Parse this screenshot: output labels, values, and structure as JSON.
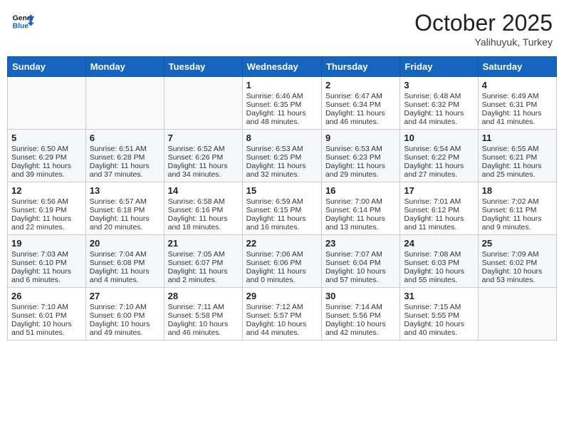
{
  "header": {
    "logo_general": "General",
    "logo_blue": "Blue",
    "month": "October 2025",
    "location": "Yalihuyuk, Turkey"
  },
  "weekdays": [
    "Sunday",
    "Monday",
    "Tuesday",
    "Wednesday",
    "Thursday",
    "Friday",
    "Saturday"
  ],
  "weeks": [
    [
      {
        "day": "",
        "content": ""
      },
      {
        "day": "",
        "content": ""
      },
      {
        "day": "",
        "content": ""
      },
      {
        "day": "1",
        "content": "Sunrise: 6:46 AM\nSunset: 6:35 PM\nDaylight: 11 hours\nand 48 minutes."
      },
      {
        "day": "2",
        "content": "Sunrise: 6:47 AM\nSunset: 6:34 PM\nDaylight: 11 hours\nand 46 minutes."
      },
      {
        "day": "3",
        "content": "Sunrise: 6:48 AM\nSunset: 6:32 PM\nDaylight: 11 hours\nand 44 minutes."
      },
      {
        "day": "4",
        "content": "Sunrise: 6:49 AM\nSunset: 6:31 PM\nDaylight: 11 hours\nand 41 minutes."
      }
    ],
    [
      {
        "day": "5",
        "content": "Sunrise: 6:50 AM\nSunset: 6:29 PM\nDaylight: 11 hours\nand 39 minutes."
      },
      {
        "day": "6",
        "content": "Sunrise: 6:51 AM\nSunset: 6:28 PM\nDaylight: 11 hours\nand 37 minutes."
      },
      {
        "day": "7",
        "content": "Sunrise: 6:52 AM\nSunset: 6:26 PM\nDaylight: 11 hours\nand 34 minutes."
      },
      {
        "day": "8",
        "content": "Sunrise: 6:53 AM\nSunset: 6:25 PM\nDaylight: 11 hours\nand 32 minutes."
      },
      {
        "day": "9",
        "content": "Sunrise: 6:53 AM\nSunset: 6:23 PM\nDaylight: 11 hours\nand 29 minutes."
      },
      {
        "day": "10",
        "content": "Sunrise: 6:54 AM\nSunset: 6:22 PM\nDaylight: 11 hours\nand 27 minutes."
      },
      {
        "day": "11",
        "content": "Sunrise: 6:55 AM\nSunset: 6:21 PM\nDaylight: 11 hours\nand 25 minutes."
      }
    ],
    [
      {
        "day": "12",
        "content": "Sunrise: 6:56 AM\nSunset: 6:19 PM\nDaylight: 11 hours\nand 22 minutes."
      },
      {
        "day": "13",
        "content": "Sunrise: 6:57 AM\nSunset: 6:18 PM\nDaylight: 11 hours\nand 20 minutes."
      },
      {
        "day": "14",
        "content": "Sunrise: 6:58 AM\nSunset: 6:16 PM\nDaylight: 11 hours\nand 18 minutes."
      },
      {
        "day": "15",
        "content": "Sunrise: 6:59 AM\nSunset: 6:15 PM\nDaylight: 11 hours\nand 16 minutes."
      },
      {
        "day": "16",
        "content": "Sunrise: 7:00 AM\nSunset: 6:14 PM\nDaylight: 11 hours\nand 13 minutes."
      },
      {
        "day": "17",
        "content": "Sunrise: 7:01 AM\nSunset: 6:12 PM\nDaylight: 11 hours\nand 11 minutes."
      },
      {
        "day": "18",
        "content": "Sunrise: 7:02 AM\nSunset: 6:11 PM\nDaylight: 11 hours\nand 9 minutes."
      }
    ],
    [
      {
        "day": "19",
        "content": "Sunrise: 7:03 AM\nSunset: 6:10 PM\nDaylight: 11 hours\nand 6 minutes."
      },
      {
        "day": "20",
        "content": "Sunrise: 7:04 AM\nSunset: 6:08 PM\nDaylight: 11 hours\nand 4 minutes."
      },
      {
        "day": "21",
        "content": "Sunrise: 7:05 AM\nSunset: 6:07 PM\nDaylight: 11 hours\nand 2 minutes."
      },
      {
        "day": "22",
        "content": "Sunrise: 7:06 AM\nSunset: 6:06 PM\nDaylight: 11 hours\nand 0 minutes."
      },
      {
        "day": "23",
        "content": "Sunrise: 7:07 AM\nSunset: 6:04 PM\nDaylight: 10 hours\nand 57 minutes."
      },
      {
        "day": "24",
        "content": "Sunrise: 7:08 AM\nSunset: 6:03 PM\nDaylight: 10 hours\nand 55 minutes."
      },
      {
        "day": "25",
        "content": "Sunrise: 7:09 AM\nSunset: 6:02 PM\nDaylight: 10 hours\nand 53 minutes."
      }
    ],
    [
      {
        "day": "26",
        "content": "Sunrise: 7:10 AM\nSunset: 6:01 PM\nDaylight: 10 hours\nand 51 minutes."
      },
      {
        "day": "27",
        "content": "Sunrise: 7:10 AM\nSunset: 6:00 PM\nDaylight: 10 hours\nand 49 minutes."
      },
      {
        "day": "28",
        "content": "Sunrise: 7:11 AM\nSunset: 5:58 PM\nDaylight: 10 hours\nand 46 minutes."
      },
      {
        "day": "29",
        "content": "Sunrise: 7:12 AM\nSunset: 5:57 PM\nDaylight: 10 hours\nand 44 minutes."
      },
      {
        "day": "30",
        "content": "Sunrise: 7:14 AM\nSunset: 5:56 PM\nDaylight: 10 hours\nand 42 minutes."
      },
      {
        "day": "31",
        "content": "Sunrise: 7:15 AM\nSunset: 5:55 PM\nDaylight: 10 hours\nand 40 minutes."
      },
      {
        "day": "",
        "content": ""
      }
    ]
  ]
}
